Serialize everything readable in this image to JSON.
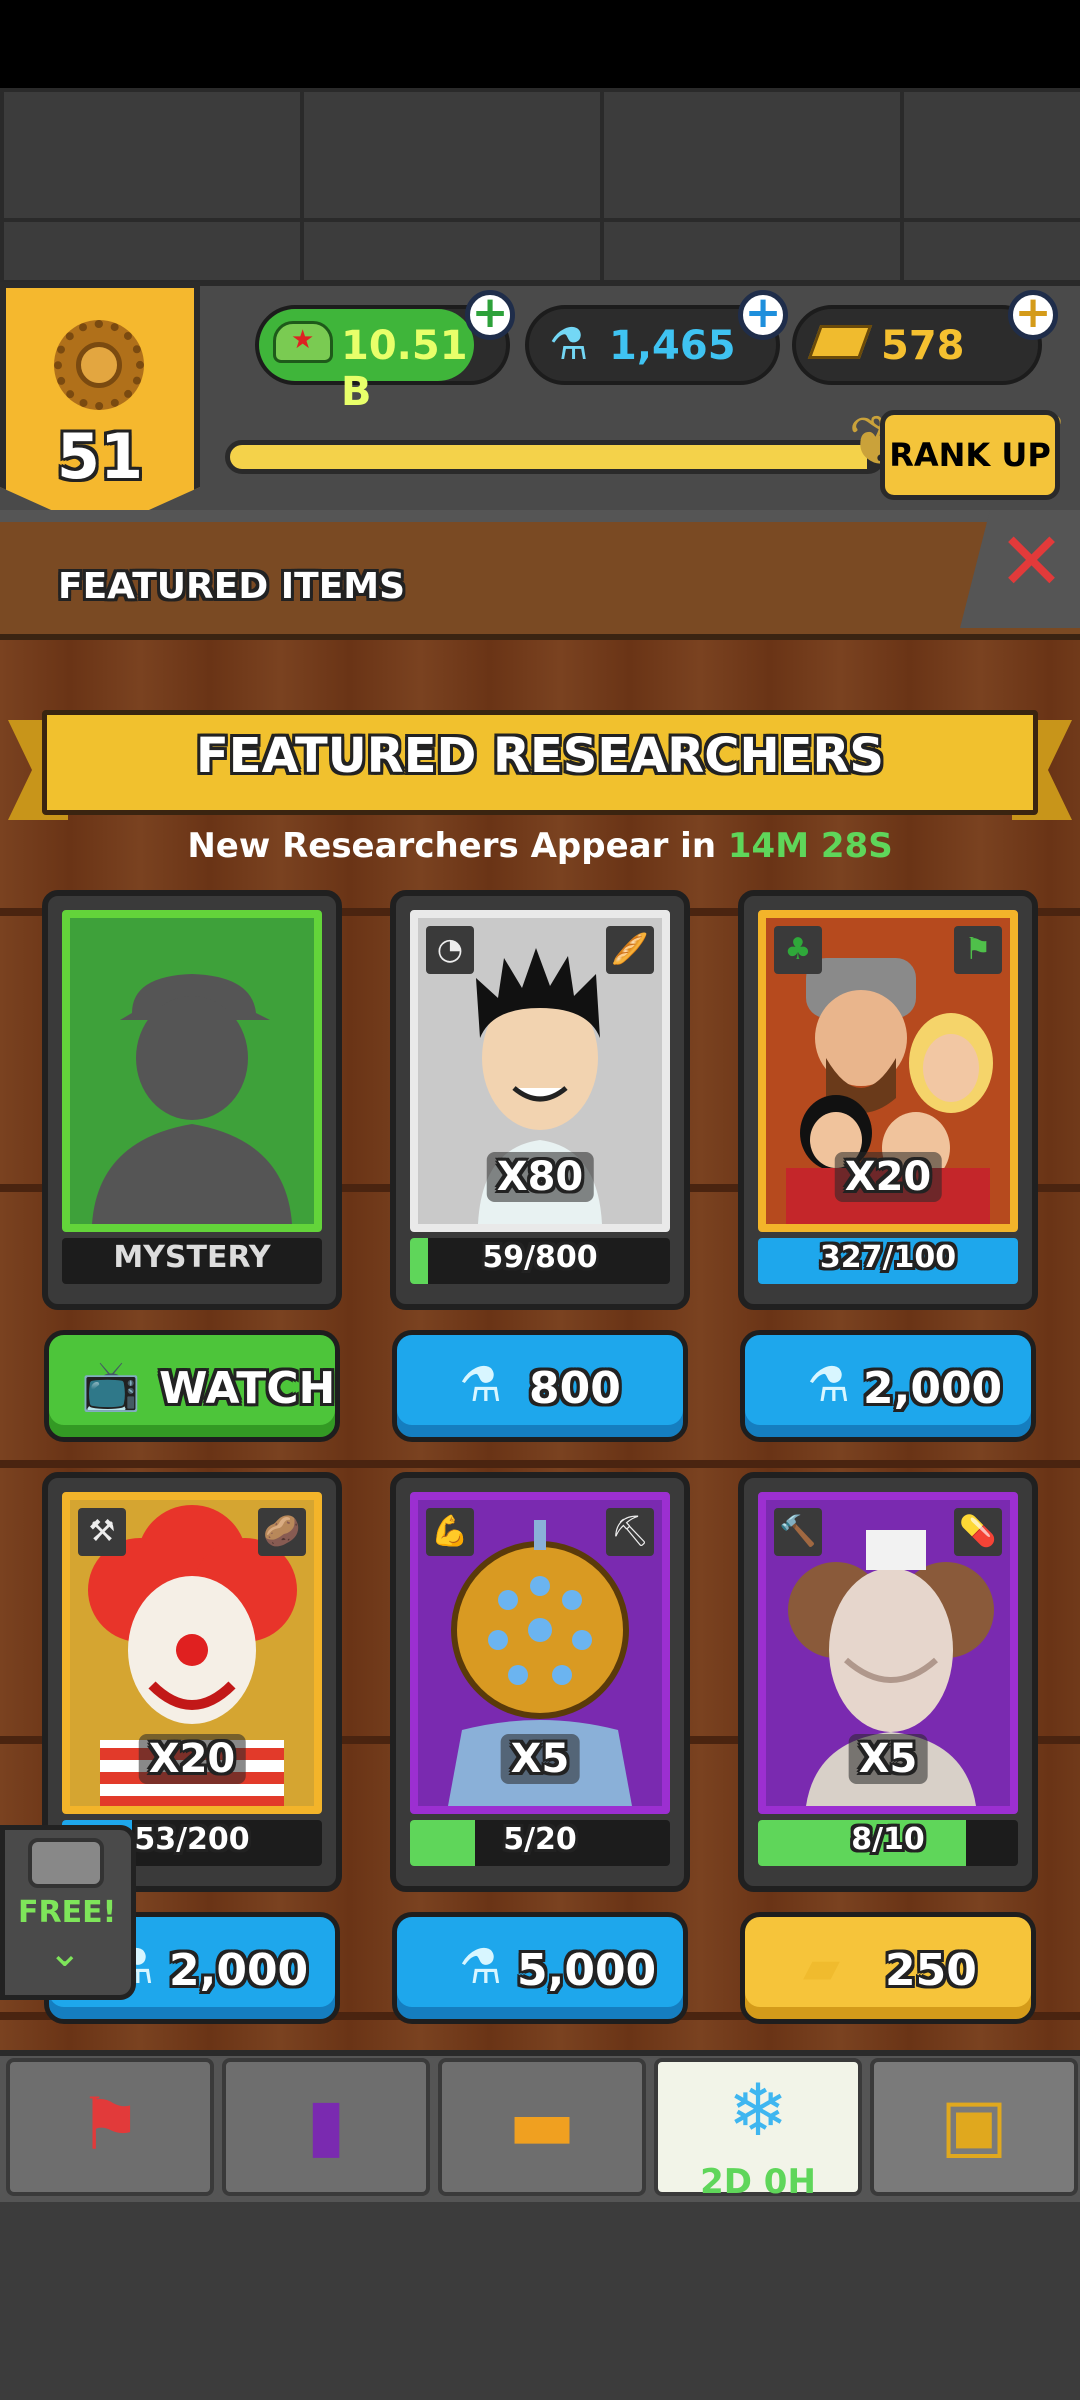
{
  "hud": {
    "rank_level": "51",
    "cash": "10.51 B",
    "flasks": "1,465",
    "gold": "578",
    "rank_up_label": "RANK UP",
    "xp_progress": 0.98,
    "plus_symbol": "+"
  },
  "header": {
    "title": "FEATURED ITEMS",
    "close_symbol": "✕"
  },
  "section": {
    "title": "FEATURED RESEARCHERS",
    "timer_prefix": "New Researchers Appear in",
    "timer_value": "14M 28S"
  },
  "cards": [
    {
      "label": "MYSTERY",
      "multiplier": "",
      "progress": "",
      "fill": 0,
      "price": "WATCH",
      "currency": "video"
    },
    {
      "label": "",
      "multiplier": "X80",
      "progress": "59/800",
      "fill": 0.07,
      "price": "800",
      "currency": "flask"
    },
    {
      "label": "",
      "multiplier": "X20",
      "progress": "327/100",
      "fill": 1.0,
      "price": "2,000",
      "currency": "flask"
    },
    {
      "label": "",
      "multiplier": "X20",
      "progress": "53/200",
      "fill": 0.27,
      "price": "2,000",
      "currency": "flask"
    },
    {
      "label": "",
      "multiplier": "X5",
      "progress": "5/20",
      "fill": 0.25,
      "price": "5,000",
      "currency": "flask"
    },
    {
      "label": "",
      "multiplier": "X5",
      "progress": "8/10",
      "fill": 0.8,
      "price": "250",
      "currency": "gold"
    }
  ],
  "free_tab": {
    "label": "FREE!"
  },
  "tabs": {
    "event_timer": "2D 0H"
  },
  "colors": {
    "bar_green": "#5fd65a",
    "bar_blue": "#1ea7ec",
    "accent_gold": "#f1c12e"
  }
}
